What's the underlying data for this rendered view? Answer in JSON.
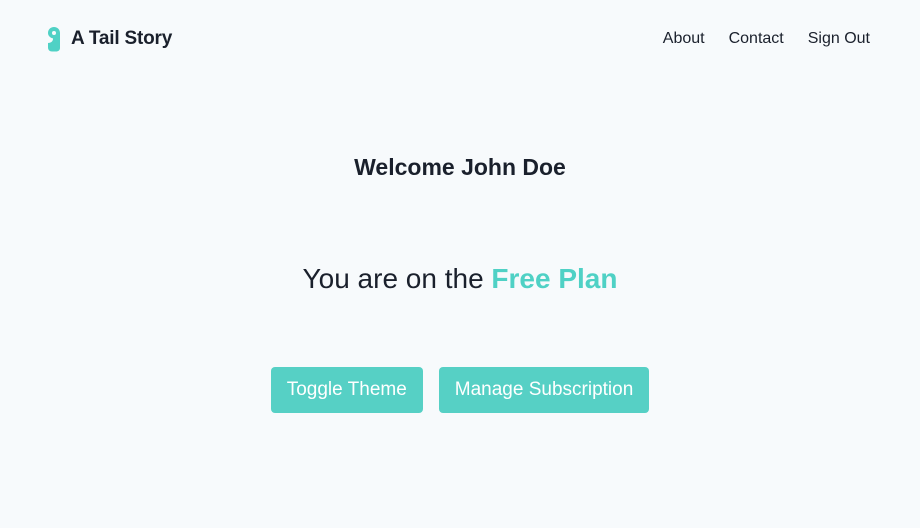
{
  "header": {
    "brand_name": "A Tail Story",
    "brand_icon": "paw-tag-icon",
    "nav": [
      {
        "label": "About"
      },
      {
        "label": "Contact"
      },
      {
        "label": "Sign Out"
      }
    ]
  },
  "main": {
    "welcome": "Welcome John Doe",
    "plan_prefix": "You are on the",
    "plan_name": "Free Plan",
    "buttons": {
      "toggle_theme": "Toggle Theme",
      "manage_subscription": "Manage Subscription"
    }
  },
  "colors": {
    "accent": "#4fd1c5",
    "background": "#f7fafc",
    "text": "#1a202c"
  }
}
